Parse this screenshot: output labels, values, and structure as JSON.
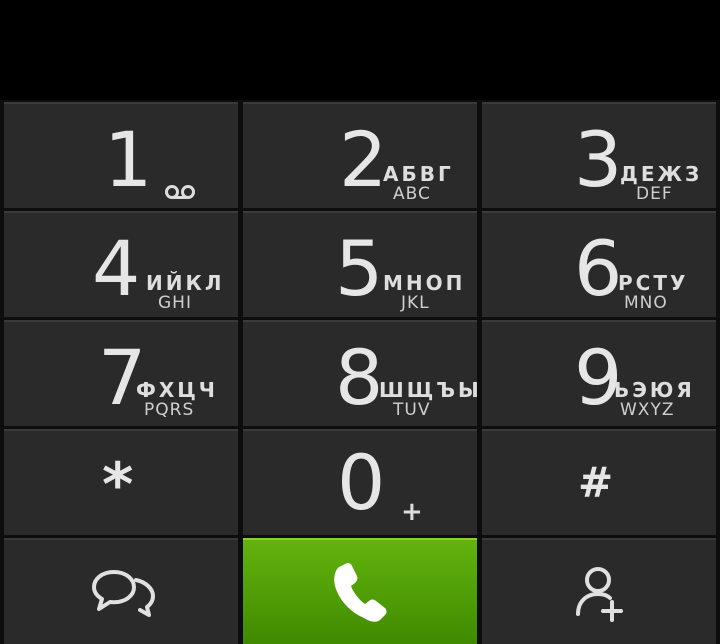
{
  "keys": [
    {
      "digit": "1",
      "cyr": "",
      "lat": "",
      "extra": "voicemail-icon"
    },
    {
      "digit": "2",
      "cyr": "АБВГ",
      "lat": "ABC"
    },
    {
      "digit": "3",
      "cyr": "ДЕЖЗ",
      "lat": "DEF"
    },
    {
      "digit": "4",
      "cyr": "ИЙКЛ",
      "lat": "GHI"
    },
    {
      "digit": "5",
      "cyr": "МНОП",
      "lat": "JKL"
    },
    {
      "digit": "6",
      "cyr": "РСТУ",
      "lat": "MNO"
    },
    {
      "digit": "7",
      "cyr": "ФХЦЧ",
      "lat": "PQRS"
    },
    {
      "digit": "8",
      "cyr": "ШЩЪЫ",
      "lat": "TUV"
    },
    {
      "digit": "9",
      "cyr": "ЬЭЮЯ",
      "lat": "WXYZ"
    },
    {
      "digit": "*"
    },
    {
      "digit": "0",
      "plus": "+"
    },
    {
      "digit": "#"
    }
  ],
  "bottom": {
    "left_icon": "messages-icon",
    "center_icon": "call-icon",
    "right_icon": "add-contact-icon",
    "call_color": "#4fa300"
  }
}
